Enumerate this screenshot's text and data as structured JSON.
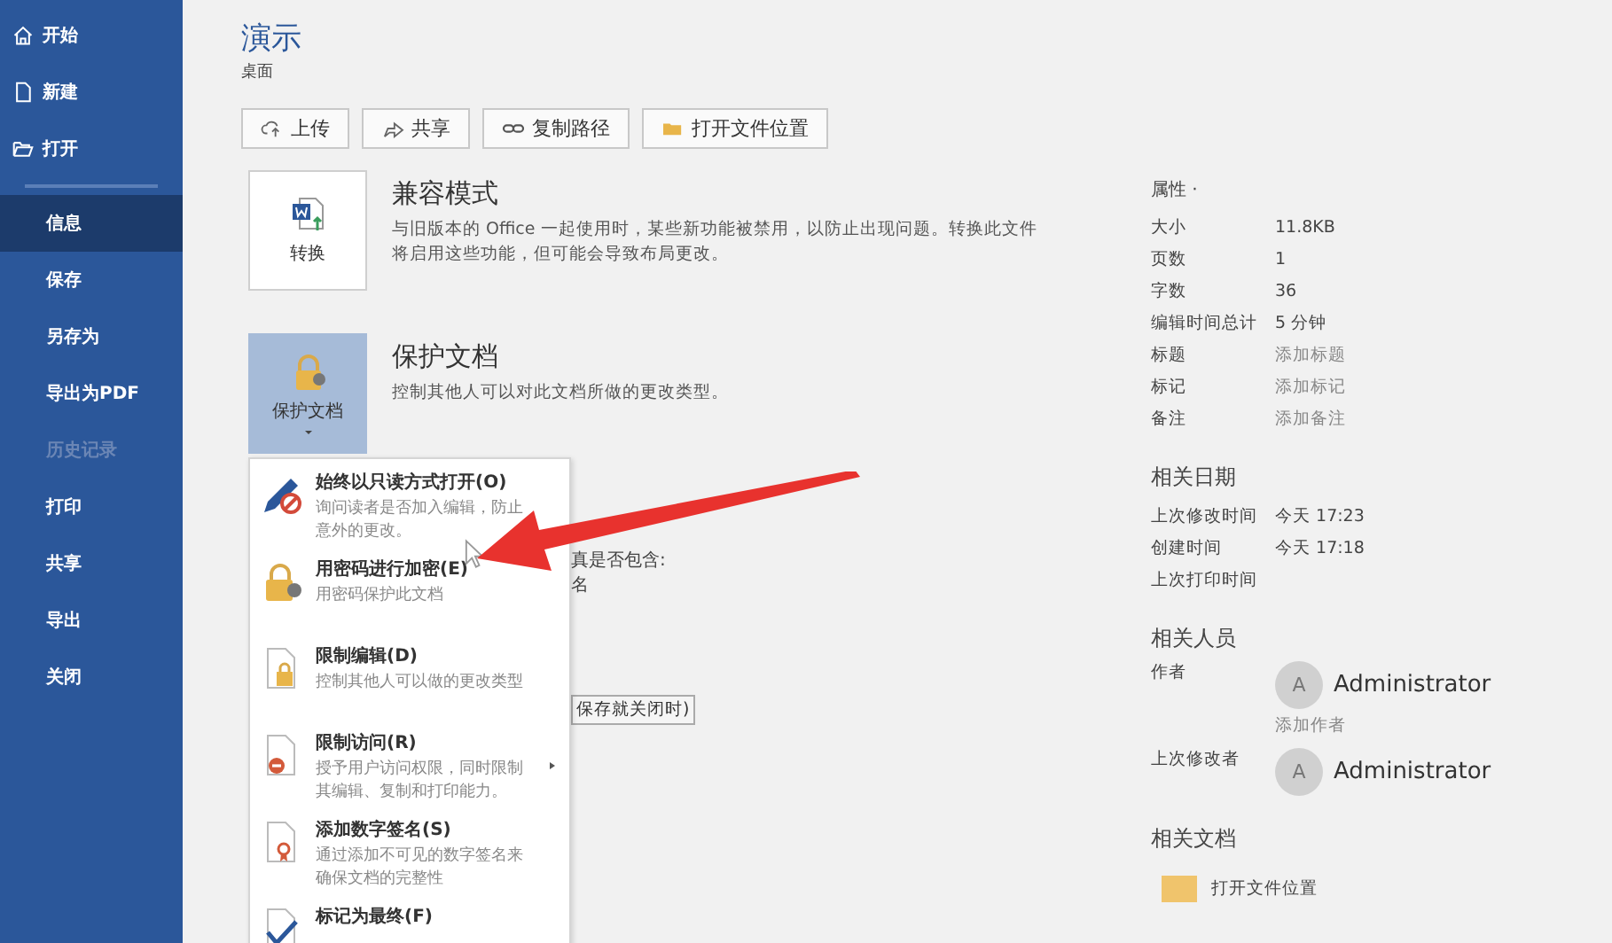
{
  "sidebar": {
    "commands": [
      "开始",
      "新建",
      "打开"
    ],
    "items": [
      {
        "label": "信息",
        "selected": true,
        "disabled": false
      },
      {
        "label": "保存",
        "selected": false,
        "disabled": false
      },
      {
        "label": "另存为",
        "selected": false,
        "disabled": false
      },
      {
        "label": "导出为PDF",
        "selected": false,
        "disabled": false
      },
      {
        "label": "历史记录",
        "selected": false,
        "disabled": true
      },
      {
        "label": "打印",
        "selected": false,
        "disabled": false
      },
      {
        "label": "共享",
        "selected": false,
        "disabled": false
      },
      {
        "label": "导出",
        "selected": false,
        "disabled": false
      },
      {
        "label": "关闭",
        "selected": false,
        "disabled": false
      }
    ]
  },
  "document": {
    "title": "演示",
    "location": "桌面"
  },
  "actions": [
    "上传",
    "共享",
    "复制路径",
    "打开文件位置"
  ],
  "sections": [
    {
      "button": "转换",
      "title": "兼容模式",
      "description": "与旧版本的 Office 一起使用时，某些新功能被禁用，以防止出现问题。转换此文件将启用这些功能，但可能会导致布局更改。",
      "selected": false
    },
    {
      "button": "保护文档",
      "title": "保护文档",
      "description": "控制其他人可以对此文档所做的更改类型。",
      "selected": true
    }
  ],
  "covered_text": {
    "line_1": "真是否包含:",
    "line_2": "名",
    "button": "保存就关闭时)"
  },
  "protect_menu": [
    {
      "title": "始终以只读方式打开(O)",
      "description": "询问读者是否加入编辑，防止意外的更改。",
      "submenu": false
    },
    {
      "title": "用密码进行加密(E)",
      "description": "用密码保护此文档",
      "submenu": false
    },
    {
      "title": "限制编辑(D)",
      "description": "控制其他人可以做的更改类型",
      "submenu": false
    },
    {
      "title": "限制访问(R)",
      "description": "授予用户访问权限，同时限制其编辑、复制和打印能力。",
      "submenu": true
    },
    {
      "title": "添加数字签名(S)",
      "description": "通过添加不可见的数字签名来确保文档的完整性",
      "submenu": false
    },
    {
      "title": "标记为最终(F)",
      "submenu": false
    }
  ],
  "properties": {
    "heading": "属性 ·",
    "rows": [
      {
        "label": "大小",
        "value": "11.8KB",
        "kind": "value"
      },
      {
        "label": "页数",
        "value": "1",
        "kind": "value"
      },
      {
        "label": "字数",
        "value": "36",
        "kind": "value"
      },
      {
        "label": "编辑时间总计",
        "value": "5 分钟",
        "kind": "value"
      },
      {
        "label": "标题",
        "placeholder": "添加标题",
        "kind": "field"
      },
      {
        "label": "标记",
        "placeholder": "添加标记",
        "kind": "field"
      },
      {
        "label": "备注",
        "placeholder": "添加备注",
        "kind": "field"
      }
    ]
  },
  "related_dates": {
    "heading": "相关日期",
    "rows": [
      {
        "label": "上次修改时间",
        "value": "今天 17:23"
      },
      {
        "label": "创建时间",
        "value": "今天 17:18"
      },
      {
        "label": "上次打印时间"
      }
    ]
  },
  "related_people": {
    "heading": "相关人员",
    "author_label": "作者",
    "author": {
      "initial": "A",
      "name": "Administrator"
    },
    "add_author": "添加作者",
    "modifier_label": "上次修改者",
    "modifier": {
      "initial": "A",
      "name": "Administrator"
    }
  },
  "related_docs": {
    "heading": "相关文档",
    "link": "打开文件位置"
  }
}
